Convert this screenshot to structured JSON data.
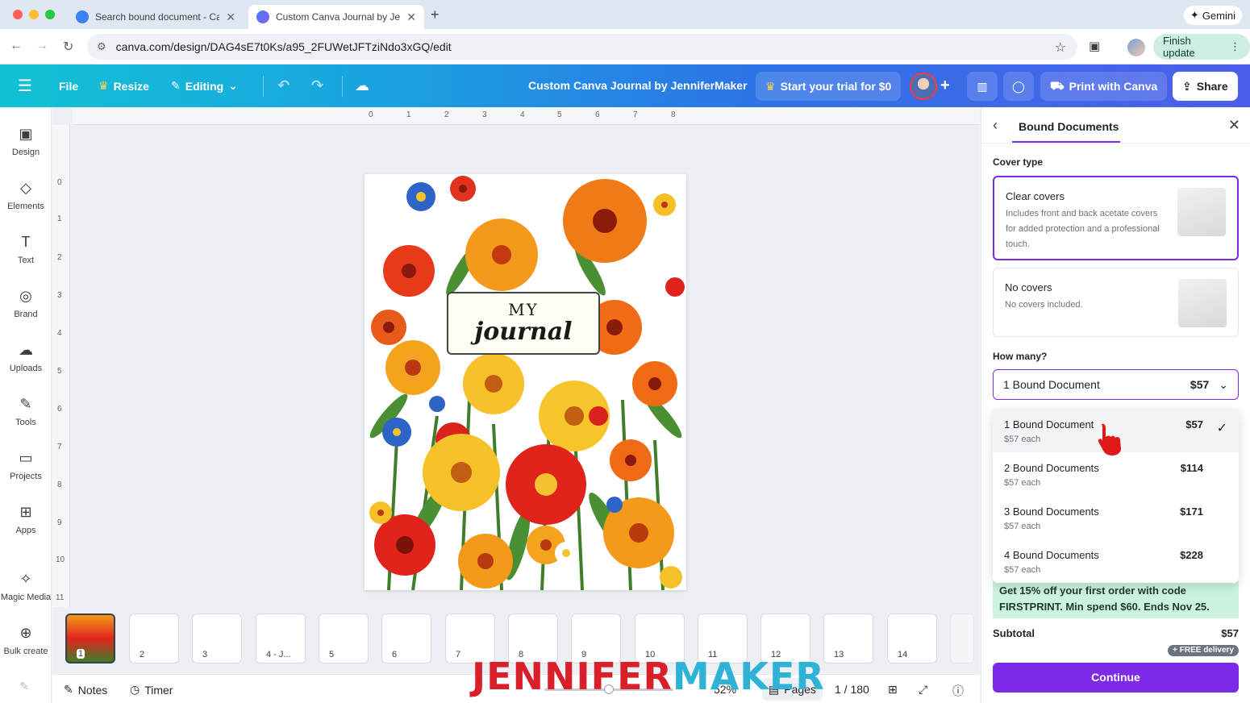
{
  "browser": {
    "tabs": [
      {
        "title": "Search bound document - Ca",
        "active": false
      },
      {
        "title": "Custom Canva Journal by Jer",
        "active": true
      }
    ],
    "url": "canva.com/design/DAG4sE7t0Ks/a95_2FUWetJFTziNdo3xGQ/edit",
    "gemini_label": "Gemini",
    "finish_update_label": "Finish update"
  },
  "header": {
    "file_label": "File",
    "resize_label": "Resize",
    "editing_label": "Editing",
    "doc_title": "Custom Canva Journal by JenniferMaker",
    "trial_label": "Start your trial for $0",
    "print_label": "Print with Canva",
    "share_label": "Share"
  },
  "sidebar": {
    "items": [
      {
        "label": "Design",
        "icon": "design-icon"
      },
      {
        "label": "Elements",
        "icon": "elements-icon"
      },
      {
        "label": "Text",
        "icon": "text-icon"
      },
      {
        "label": "Brand",
        "icon": "brand-icon"
      },
      {
        "label": "Uploads",
        "icon": "uploads-icon"
      },
      {
        "label": "Tools",
        "icon": "tools-icon"
      },
      {
        "label": "Projects",
        "icon": "projects-icon"
      },
      {
        "label": "Apps",
        "icon": "apps-icon"
      },
      {
        "label": "Magic Media",
        "icon": "magic-media-icon"
      },
      {
        "label": "Bulk create",
        "icon": "bulk-create-icon"
      }
    ]
  },
  "ruler": {
    "top": [
      "0",
      "1",
      "2",
      "3",
      "4",
      "5",
      "6",
      "7",
      "8"
    ],
    "left": [
      "0",
      "1",
      "2",
      "3",
      "4",
      "5",
      "6",
      "7",
      "8",
      "9",
      "10",
      "11"
    ]
  },
  "canvas": {
    "journal_my": "MY",
    "journal_word": "journal"
  },
  "thumbnails": [
    "1",
    "2",
    "3",
    "4 - J...",
    "5",
    "6",
    "7",
    "8",
    "9",
    "10",
    "11",
    "12",
    "13",
    "14"
  ],
  "bottombar": {
    "notes_label": "Notes",
    "timer_label": "Timer",
    "zoom": "52%",
    "pages_label": "Pages",
    "page_counter": "1 / 180"
  },
  "watermark": {
    "part1": "JENNIFER",
    "part2": "MAKER"
  },
  "panel": {
    "title": "Bound Documents",
    "cover_type_label": "Cover type",
    "covers": [
      {
        "title": "Clear covers",
        "desc": "Includes front and back acetate covers for added protection and a professional touch.",
        "selected": true
      },
      {
        "title": "No covers",
        "desc": "No covers included.",
        "selected": false
      }
    ],
    "how_many_label": "How many?",
    "select_value": "1 Bound Document",
    "select_price": "$57",
    "options": [
      {
        "label": "1 Bound Document",
        "sub": "$57 each",
        "price": "$57",
        "selected": true
      },
      {
        "label": "2 Bound Documents",
        "sub": "$57 each",
        "price": "$114",
        "selected": false
      },
      {
        "label": "3 Bound Documents",
        "sub": "$57 each",
        "price": "$171",
        "selected": false
      },
      {
        "label": "4 Bound Documents",
        "sub": "$57 each",
        "price": "$228",
        "selected": false
      }
    ],
    "promo_text": "Get 15% off your first order with code FIRSTPRINT. Min spend $60. Ends Nov 25.",
    "subtotal_label": "Subtotal",
    "subtotal_value": "$57",
    "free_delivery": "+ FREE delivery",
    "continue_label": "Continue"
  },
  "colors": {
    "accent": "#7d2ae8",
    "promo_bg": "#cbf3df",
    "watermark_red": "#d81f2a",
    "watermark_blue": "#2eb3d6"
  }
}
